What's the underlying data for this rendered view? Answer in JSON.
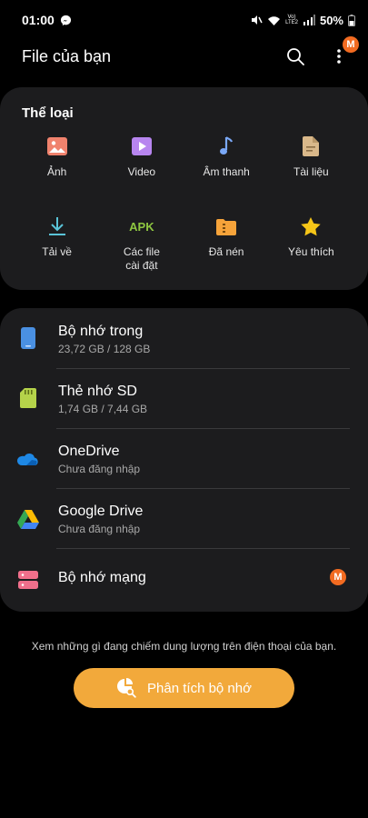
{
  "status_bar": {
    "time": "01:00",
    "battery": "50%",
    "volte_top": "Vo)",
    "volte_bottom": "LTE2"
  },
  "app_bar": {
    "title": "File của bạn",
    "search_icon": "search-icon",
    "more_icon": "more-vert-icon",
    "more_badge": "M"
  },
  "categories": {
    "heading": "Thể loại",
    "items": [
      {
        "label": "Ảnh",
        "icon": "image-icon",
        "color": "#f0826d"
      },
      {
        "label": "Video",
        "icon": "video-icon",
        "color": "#b785ef"
      },
      {
        "label": "Âm thanh",
        "icon": "music-note-icon",
        "color": "#7aa8f7"
      },
      {
        "label": "Tài liệu",
        "icon": "document-icon",
        "color": "#d9b88a"
      },
      {
        "label": "Tải về",
        "icon": "download-icon",
        "color": "#5ac4d8"
      },
      {
        "label": "Các file\ncài đặt",
        "icon": "apk-icon",
        "apk_text": "APK",
        "color": "#8ec641"
      },
      {
        "label": "Đã nén",
        "icon": "archive-icon",
        "color": "#f6a33a"
      },
      {
        "label": "Yêu thích",
        "icon": "star-icon",
        "color": "#f5c518"
      }
    ]
  },
  "storage": {
    "items": [
      {
        "title": "Bộ nhớ trong",
        "subtitle": "23,72 GB / 128 GB",
        "icon": "phone-icon",
        "color": "#4a90e2"
      },
      {
        "title": "Thẻ nhớ SD",
        "subtitle": "1,74 GB / 7,44 GB",
        "icon": "sd-card-icon",
        "color": "#b5d34a"
      },
      {
        "title": "OneDrive",
        "subtitle": "Chưa đăng nhập",
        "icon": "onedrive-icon",
        "color": "#1e88e5"
      },
      {
        "title": "Google Drive",
        "subtitle": "Chưa đăng nhập",
        "icon": "google-drive-icon",
        "color": "#34a853"
      },
      {
        "title": "Bộ nhớ mạng",
        "subtitle": "",
        "icon": "network-storage-icon",
        "color": "#f06f8b",
        "badge": "M"
      }
    ]
  },
  "footer": {
    "hint": "Xem những gì đang chiếm dung lượng trên điện thoại của bạn.",
    "analyze_label": "Phân tích bộ nhớ",
    "analyze_icon": "storage-analysis-icon",
    "accent": "#f2a93b"
  }
}
